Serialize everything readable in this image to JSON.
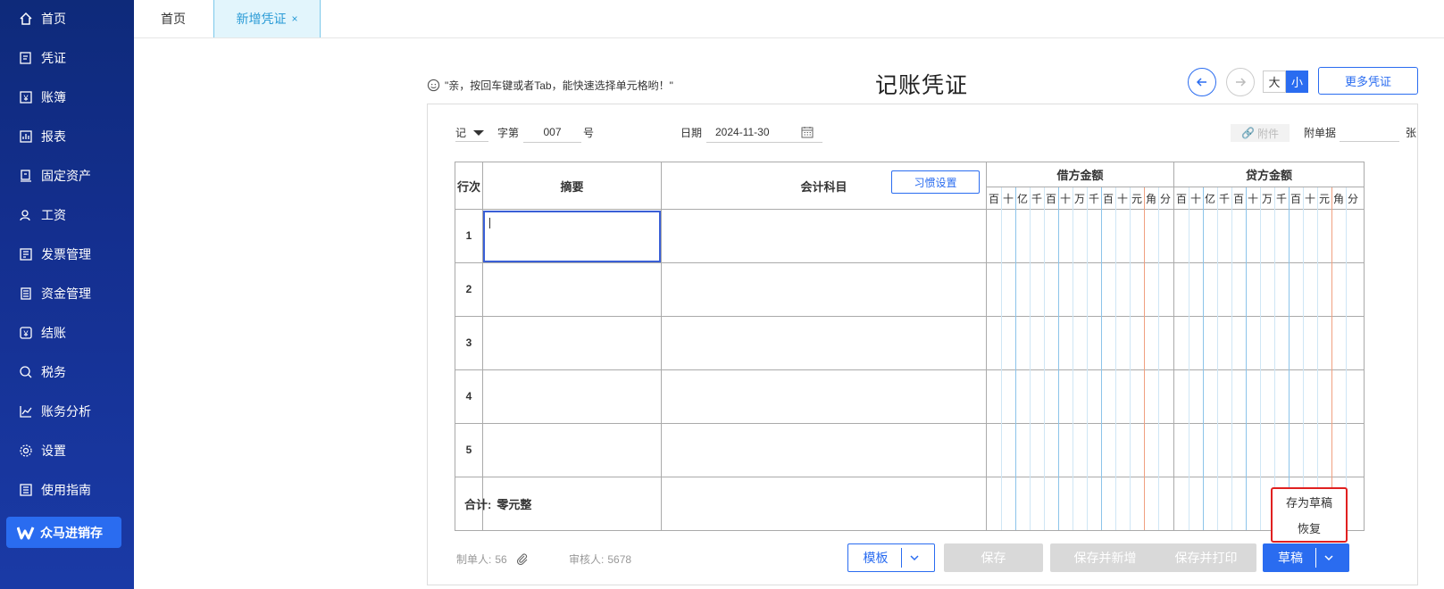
{
  "sidebar": {
    "items": [
      {
        "label": "首页",
        "icon": "home-icon"
      },
      {
        "label": "凭证",
        "icon": "voucher-icon"
      },
      {
        "label": "账簿",
        "icon": "ledger-icon"
      },
      {
        "label": "报表",
        "icon": "report-icon"
      },
      {
        "label": "固定资产",
        "icon": "fixed-asset-icon"
      },
      {
        "label": "工资",
        "icon": "salary-icon"
      },
      {
        "label": "发票管理",
        "icon": "invoice-icon"
      },
      {
        "label": "资金管理",
        "icon": "fund-icon"
      },
      {
        "label": "结账",
        "icon": "closing-icon"
      },
      {
        "label": "税务",
        "icon": "tax-icon"
      },
      {
        "label": "账务分析",
        "icon": "analysis-icon"
      },
      {
        "label": "设置",
        "icon": "gear-icon"
      },
      {
        "label": "使用指南",
        "icon": "guide-icon"
      }
    ],
    "brand": "众马进销存"
  },
  "tabs": {
    "home": "首页",
    "active": "新增凭证",
    "close": "×"
  },
  "header": {
    "hint": "\"亲，按回车键或者Tab，能快速选择单元格哟！\"",
    "title": "记账凭证",
    "size_big": "大",
    "size_small": "小",
    "more": "更多凭证"
  },
  "voucher": {
    "type_label": "记",
    "zi_label": "字第",
    "number": "007",
    "hao_label": "号",
    "date_label": "日期",
    "date": "2024-11-30",
    "attach_button": "附件",
    "attach_label": "附单据",
    "attach_unit": "张"
  },
  "table": {
    "col_row": "行次",
    "col_summary": "摘要",
    "col_account": "会计科目",
    "habit_button": "习惯设置",
    "debit": "借方金额",
    "credit": "贷方金额",
    "digits": [
      "百",
      "十",
      "亿",
      "千",
      "百",
      "十",
      "万",
      "千",
      "百",
      "十",
      "元",
      "角",
      "分"
    ],
    "rows": [
      "1",
      "2",
      "3",
      "4",
      "5"
    ],
    "total_label": "合计:",
    "total_value": "零元整"
  },
  "footer": {
    "maker_label": "制单人:",
    "maker": "56",
    "auditor_label": "审核人:",
    "auditor": "5678",
    "template": "模板",
    "save": "保存",
    "save_new": "保存并新增",
    "save_print": "保存并打印",
    "draft": "草稿"
  },
  "popup": {
    "save_draft": "存为草稿",
    "restore": "恢复"
  },
  "colors": {
    "primary": "#2a6cf0",
    "sidebar": "#142f8f",
    "highlight": "#e02020"
  }
}
